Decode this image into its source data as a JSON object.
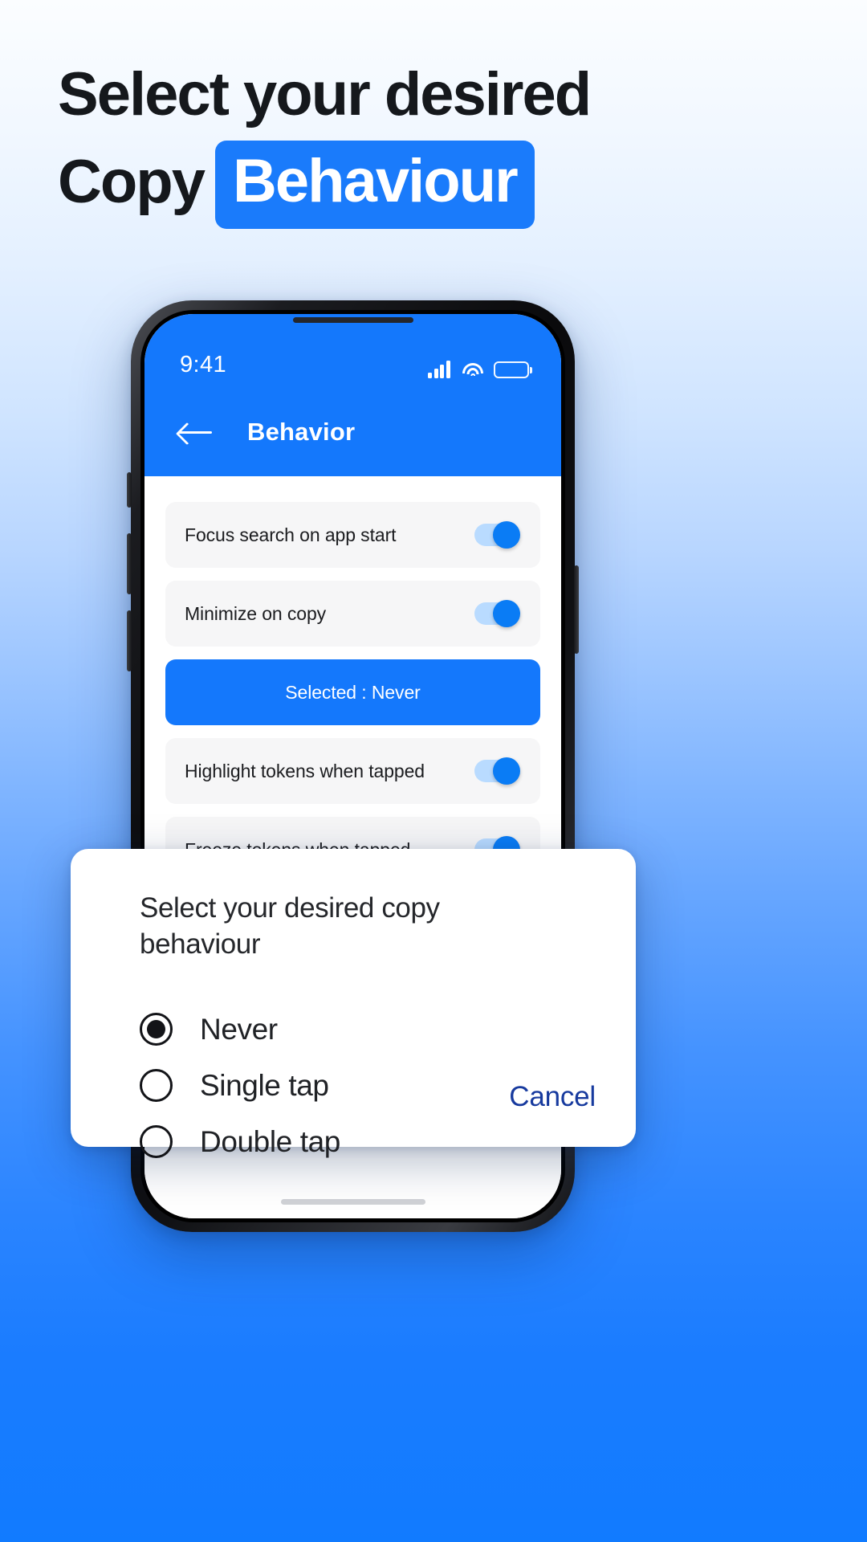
{
  "headline": {
    "line1": "Select your desired",
    "line2_prefix": "Copy",
    "line2_highlight": "Behaviour"
  },
  "colors": {
    "accent_blue": "#1478fc",
    "highlight_blue": "#1a7bfb",
    "row_gray": "#f6f6f7",
    "toggle_track": "#b9dbff",
    "toggle_thumb": "#0a7cf5",
    "cancel_blue": "#173a9e",
    "text_dark": "#15181c"
  },
  "phone": {
    "status_bar": {
      "time": "9:41",
      "icons": [
        "signal-icon",
        "wifi-icon",
        "battery-icon"
      ]
    },
    "toolbar": {
      "back_icon": "back-arrow-icon",
      "title": "Behavior"
    },
    "settings": {
      "rows": [
        {
          "label": "Focus search on app start",
          "toggle": "on"
        },
        {
          "label": "Minimize on copy",
          "toggle": "on"
        }
      ],
      "selected_button": "Selected : Never",
      "rows_after": [
        {
          "label": "Highlight tokens when tapped",
          "toggle": "on"
        },
        {
          "label": "Freeze tokens when tapped",
          "toggle": "on"
        }
      ]
    }
  },
  "dialog": {
    "title": "Select your desired copy behaviour",
    "options": [
      {
        "label": "Never",
        "selected": true
      },
      {
        "label": "Single tap",
        "selected": false
      },
      {
        "label": "Double tap",
        "selected": false
      }
    ],
    "cancel_label": "Cancel"
  }
}
